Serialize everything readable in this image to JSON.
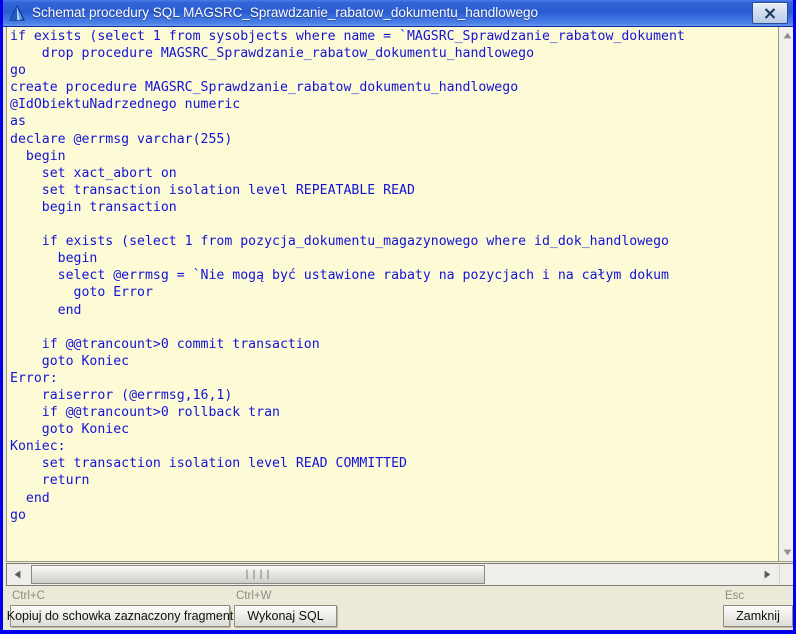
{
  "window": {
    "title": "Schemat procedury SQL MAGSRC_Sprawdzanie_rabatow_dokumentu_handlowego",
    "icon": "pyramid-icon",
    "close_icon": "close-icon",
    "accent_border_color": "#0000ee",
    "titlebar_color": "#2a5ad0",
    "code_background_color": "#fdfbd6",
    "code_text_color": "#1313d6"
  },
  "code": {
    "language": "sql",
    "text": "if exists (select 1 from sysobjects where name = `MAGSRC_Sprawdzanie_rabatow_dokument\n    drop procedure MAGSRC_Sprawdzanie_rabatow_dokumentu_handlowego\ngo\ncreate procedure MAGSRC_Sprawdzanie_rabatow_dokumentu_handlowego\n@IdObiektuNadrzednego numeric\nas\ndeclare @errmsg varchar(255)\n  begin\n    set xact_abort on\n    set transaction isolation level REPEATABLE READ\n    begin transaction\n\n    if exists (select 1 from pozycja_dokumentu_magazynowego where id_dok_handlowego\n      begin\n      select @errmsg = `Nie mogą być ustawione rabaty na pozycjach i na całym dokum\n        goto Error\n      end\n\n    if @@trancount>0 commit transaction\n    goto Koniec\nError:\n    raiserror (@errmsg,16,1)\n    if @@trancount>0 rollback tran\n    goto Koniec\nKoniec:\n    set transaction isolation level READ COMMITTED\n    return\n  end\ngo"
  },
  "scrollbars": {
    "vertical": {
      "up_icon": "scroll-up-arrow-icon",
      "down_icon": "scroll-down-arrow-icon"
    },
    "horizontal": {
      "left_icon": "scroll-left-arrow-icon",
      "right_icon": "scroll-right-arrow-icon",
      "grip": "||||"
    }
  },
  "footer": {
    "buttons": [
      {
        "shortcut": "Ctrl+C",
        "label": "Kopiuj do schowka zaznaczony fragment"
      },
      {
        "shortcut": "Ctrl+W",
        "label": "Wykonaj SQL"
      },
      {
        "shortcut": "Esc",
        "label": "Zamknij"
      }
    ]
  }
}
